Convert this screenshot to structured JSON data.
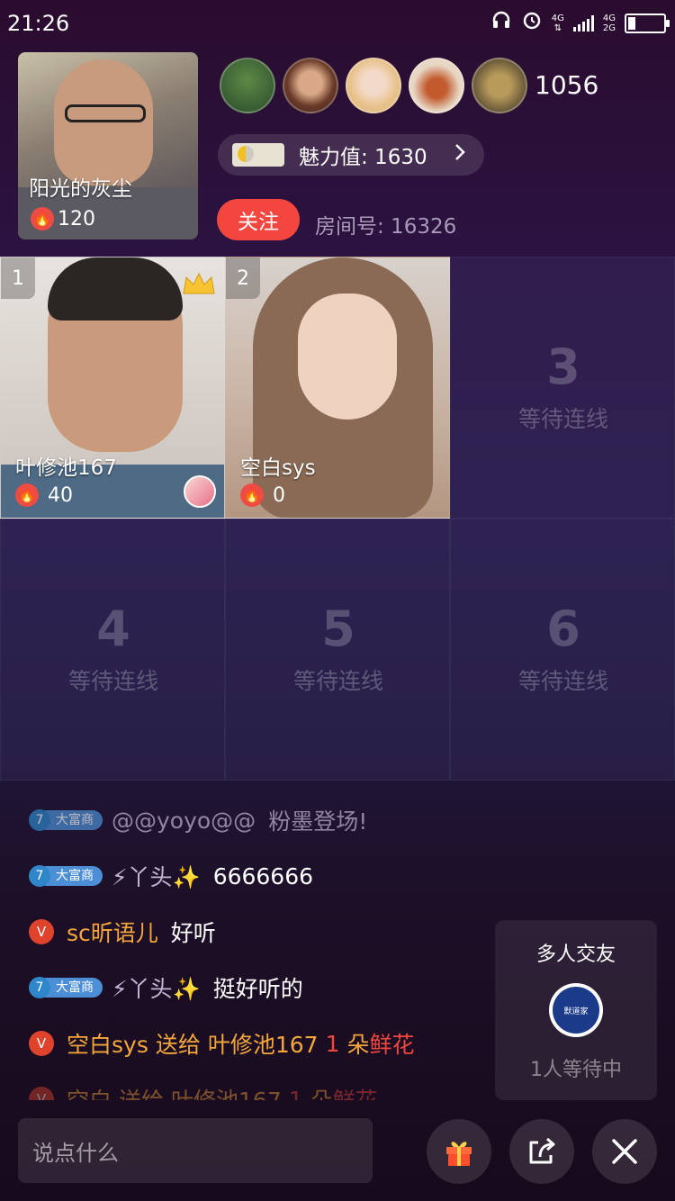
{
  "status_bar": {
    "time": "21:26",
    "net_top": "4G",
    "net_bottom": "2G",
    "battery_level": 0.2
  },
  "host": {
    "name": "阳光的灰尘",
    "heat": "120"
  },
  "audience": {
    "count": "1056"
  },
  "charm": {
    "text": "魅力值: 1630",
    "badge_level": "1"
  },
  "follow": {
    "label": "关注"
  },
  "room": {
    "text": "房间号: 16326"
  },
  "grid": {
    "cells": [
      {
        "index": "1",
        "name": "叶修池167",
        "heat": "40"
      },
      {
        "index": "2",
        "name": "空白sys",
        "heat": "0"
      },
      {
        "number": "3",
        "text": "等待连线"
      },
      {
        "number": "4",
        "text": "等待连线"
      },
      {
        "number": "5",
        "text": "等待连线"
      },
      {
        "number": "6",
        "text": "等待连线"
      }
    ]
  },
  "chat": {
    "messages": [
      {
        "level": "7",
        "tag": "大富商",
        "user": "@@yoyo@@",
        "text": "粉墨登场!"
      },
      {
        "level": "7",
        "tag": "大富商",
        "user": "⚡丫头✨",
        "text": "6666666"
      },
      {
        "badge": "V",
        "user": "sc昕语儿",
        "text": "好听"
      },
      {
        "level": "7",
        "tag": "大富商",
        "user": "⚡丫头✨",
        "text": "挺好听的"
      },
      {
        "badge": "V",
        "user": "空白sys",
        "verb": "送给",
        "target": "叶修池167",
        "qty": "1",
        "unit": "朵",
        "gift": "鲜花"
      },
      {
        "badge": "V",
        "user": "空白",
        "verb": "送给",
        "target": "叶修池167",
        "qty": "1",
        "unit": "朵",
        "gift": "鲜花"
      }
    ]
  },
  "side_panel": {
    "title": "多人交友",
    "avatar_text": "默道家",
    "waiting": "1人等待中"
  },
  "bottom_bar": {
    "input_placeholder": "说点什么"
  },
  "icons": {
    "gift": "gift-icon",
    "share": "share-icon",
    "close": "close-icon",
    "fire": "fire-icon",
    "crown": "crown-icon",
    "headphones": "headphones-icon",
    "alarm": "alarm-icon",
    "chevron": "chevron-right-icon"
  },
  "colors": {
    "accent_red": "#f2463f",
    "name_orange": "#f4a63b",
    "level_blue": "#4c8fd6"
  }
}
